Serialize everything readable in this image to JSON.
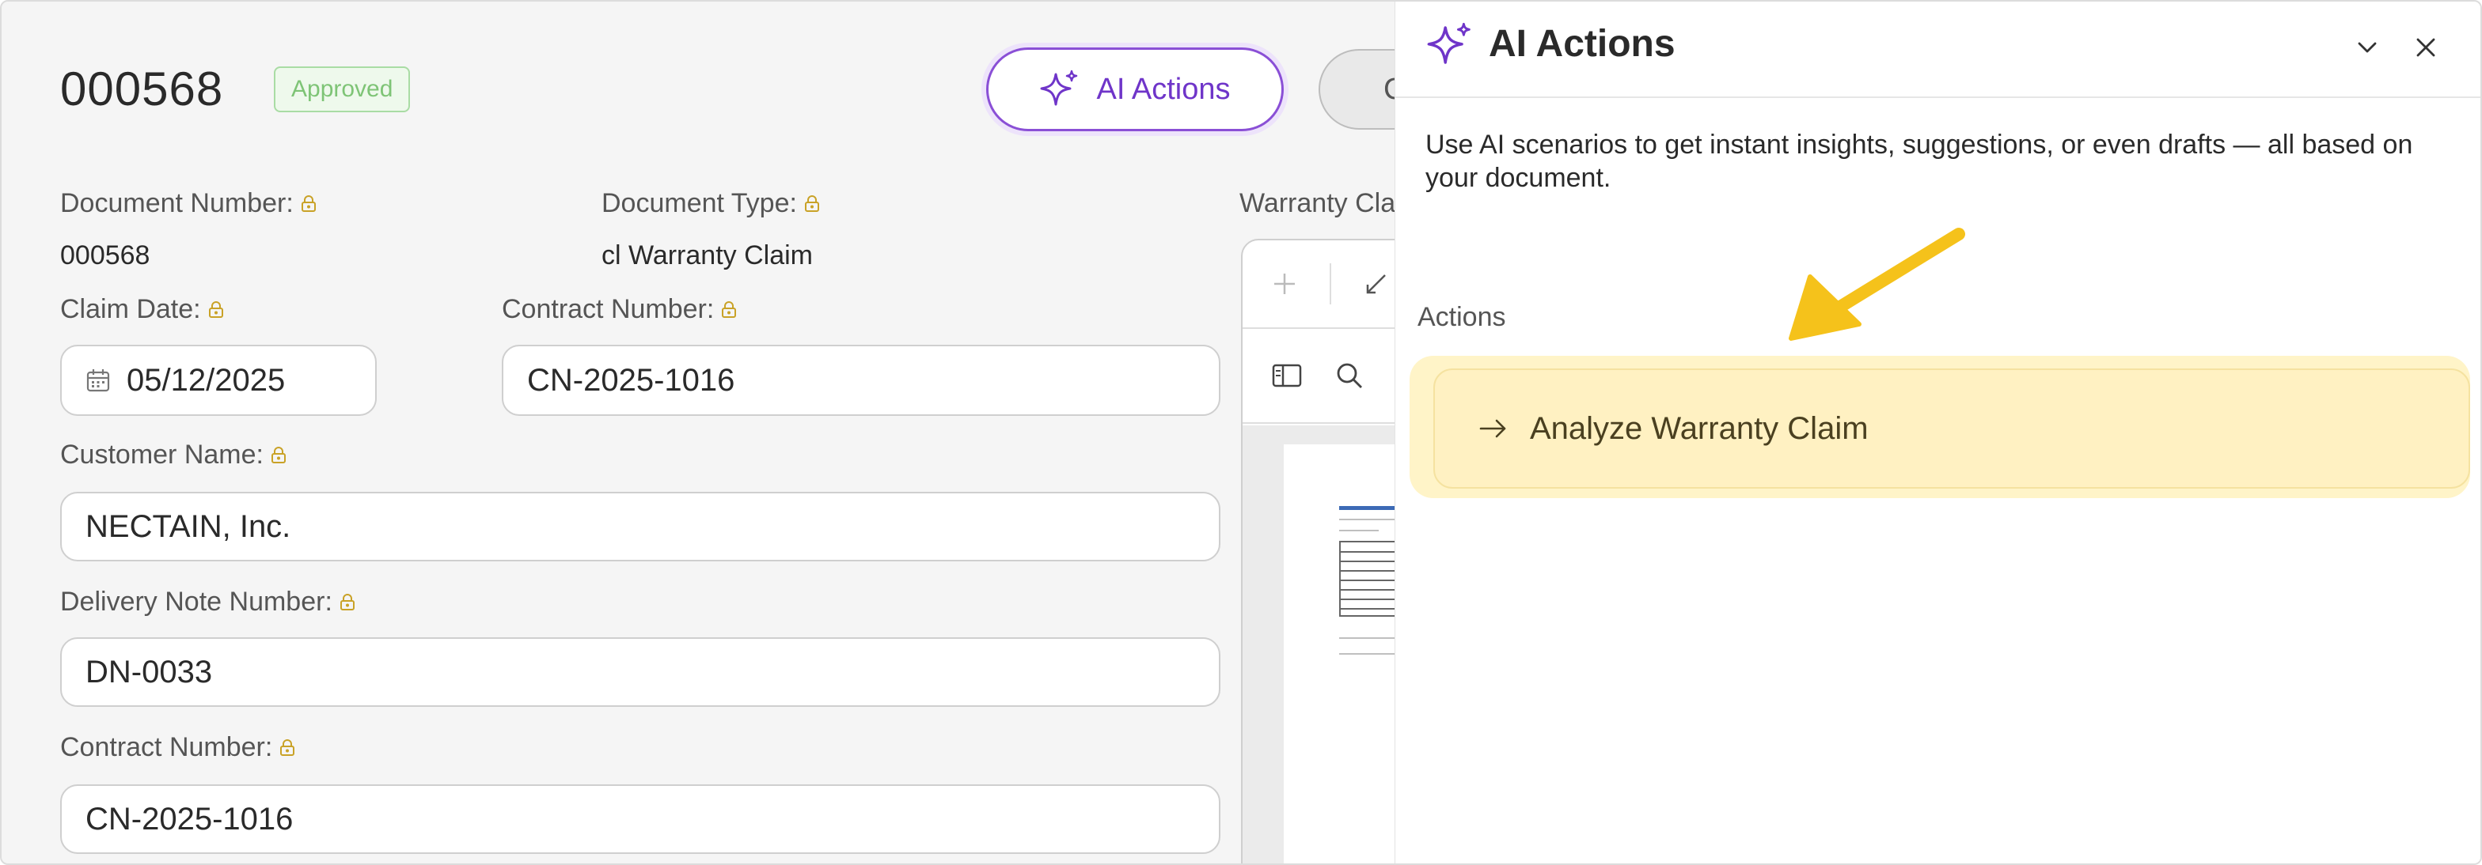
{
  "document": {
    "number": "000568",
    "status": "Approved",
    "ai_button_label": "AI Actions",
    "secondary_button_label": "C"
  },
  "fields": {
    "document_number": {
      "label": "Document Number:",
      "value": "000568"
    },
    "document_type": {
      "label": "Document Type:",
      "value": "cl Warranty Claim"
    },
    "claim_date": {
      "label": "Claim Date:",
      "value": "05/12/2025"
    },
    "contract_number_top": {
      "label": "Contract Number:",
      "value": "CN-2025-1016"
    },
    "customer_name": {
      "label": "Customer Name:",
      "value": "NECTAIN, Inc."
    },
    "delivery_note_number": {
      "label": "Delivery Note Number:",
      "value": "DN-0033"
    },
    "contract_number_bottom": {
      "label": "Contract Number:",
      "value": "CN-2025-1016"
    }
  },
  "preview": {
    "label": "Warranty Cla"
  },
  "ai_panel": {
    "title": "AI Actions",
    "description": "Use AI scenarios to get instant insights, suggestions, or even drafts — all based on your document.",
    "actions_heading": "Actions",
    "actions": [
      {
        "label": "Analyze Warranty Claim"
      }
    ]
  },
  "colors": {
    "accent_purple": "#6f35c9",
    "approved_green": "#7ec476",
    "action_highlight": "#fff1c2",
    "callout_arrow": "#f5c21b",
    "lock_icon": "#c9a227"
  }
}
